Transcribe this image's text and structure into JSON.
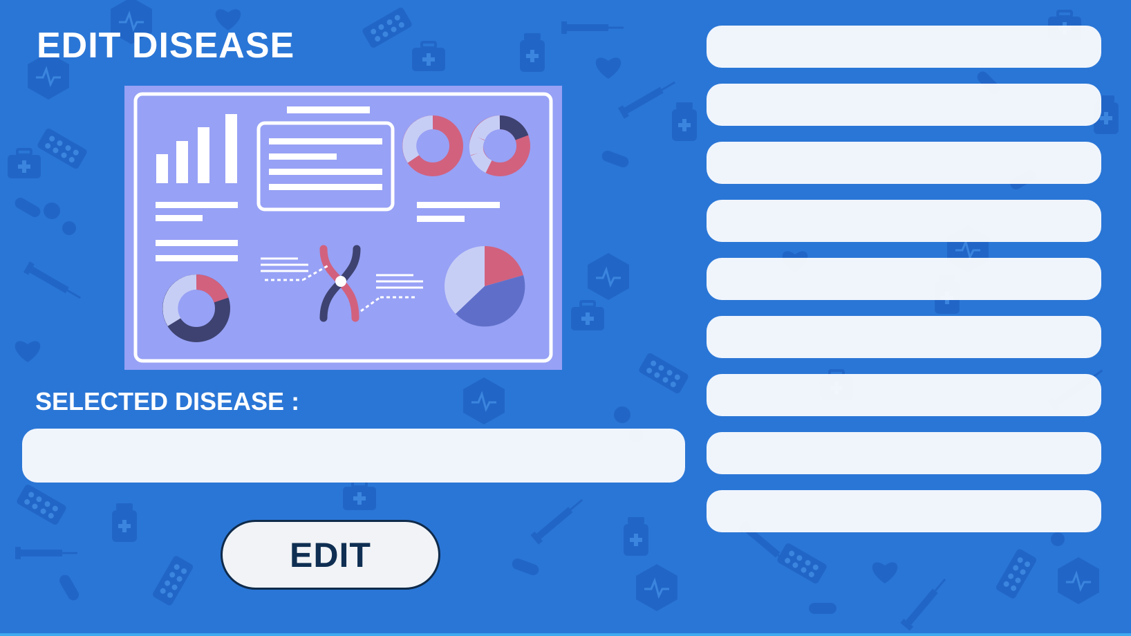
{
  "header": {
    "title": "EDIT DISEASE"
  },
  "form": {
    "selected_label": "SELECTED DISEASE :",
    "selected_value": "",
    "edit_label": "EDIT"
  },
  "disease_list": {
    "items": [
      {
        "label": ""
      },
      {
        "label": ""
      },
      {
        "label": ""
      },
      {
        "label": ""
      },
      {
        "label": ""
      },
      {
        "label": ""
      },
      {
        "label": ""
      },
      {
        "label": ""
      },
      {
        "label": ""
      }
    ]
  },
  "colors": {
    "background": "#2a76d6",
    "illustration_panel": "#97a1f5",
    "accent_pink": "#d2617e",
    "dark_navy": "#3d4270",
    "button_text": "#0f2e52"
  },
  "icons": [
    "bar-chart-icon",
    "donut-chart-icon",
    "pie-chart-icon",
    "chromosome-icon",
    "document-card-icon"
  ]
}
